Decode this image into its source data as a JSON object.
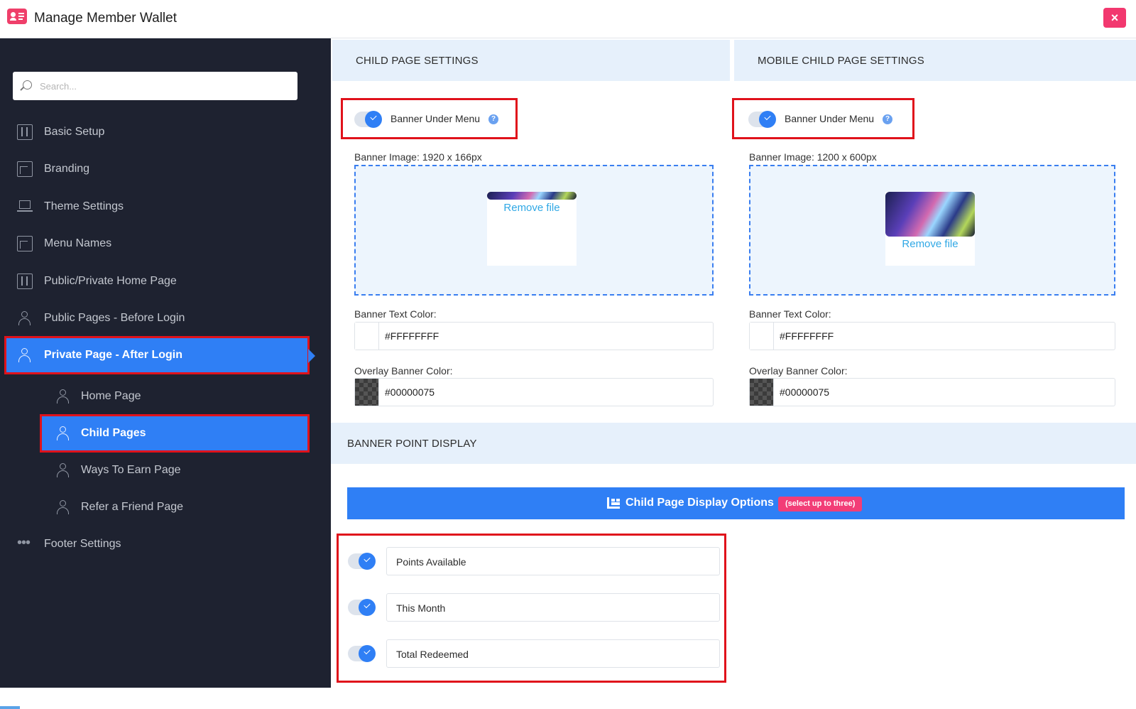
{
  "app": {
    "title": "Manage Member Wallet",
    "close_symbol": "×"
  },
  "sidebar": {
    "search_placeholder": "Search...",
    "items": [
      {
        "label": "Basic Setup",
        "icon": "sliders-icon"
      },
      {
        "label": "Branding",
        "icon": "frame-icon"
      },
      {
        "label": "Theme Settings",
        "icon": "laptop-icon"
      },
      {
        "label": "Menu Names",
        "icon": "frame-icon"
      },
      {
        "label": "Public/Private Home Page",
        "icon": "sliders-icon"
      },
      {
        "label": "Public Pages - Before Login",
        "icon": "person-icon"
      },
      {
        "label": "Private Page - After Login",
        "icon": "person-icon",
        "active": true
      },
      {
        "label": "Home Page",
        "icon": "person-icon"
      },
      {
        "label": "Child Pages",
        "icon": "person-icon",
        "active": true
      },
      {
        "label": "Ways To Earn Page",
        "icon": "person-icon"
      },
      {
        "label": "Refer a Friend Page",
        "icon": "person-icon"
      },
      {
        "label": "Footer Settings",
        "icon": "more-dots-icon"
      }
    ]
  },
  "child_settings": {
    "heading": "CHILD PAGE SETTINGS",
    "banner_toggle_label": "Banner Under Menu",
    "banner_toggle_on": true,
    "help_symbol": "?",
    "banner_image_label": "Banner Image: 1920 x 166px",
    "remove_file": "Remove file",
    "text_color_label": "Banner Text Color:",
    "text_color_value": "#FFFFFFFF",
    "overlay_label": "Overlay Banner Color:",
    "overlay_value": "#00000075"
  },
  "mobile_settings": {
    "heading": "MOBILE CHILD PAGE SETTINGS",
    "banner_toggle_label": "Banner Under Menu",
    "banner_toggle_on": true,
    "help_symbol": "?",
    "banner_image_label": "Banner Image: 1200 x 600px",
    "remove_file": "Remove file",
    "text_color_label": "Banner Text Color:",
    "text_color_value": "#FFFFFFFF",
    "overlay_label": "Overlay Banner Color:",
    "overlay_value": "#00000075"
  },
  "point_display": {
    "heading": "BANNER POINT DISPLAY",
    "options_title": "Child Page Display Options",
    "options_badge": "(select up to three)",
    "options": [
      {
        "label": "Points Available",
        "enabled": true
      },
      {
        "label": "This Month",
        "enabled": true
      },
      {
        "label": "Total Redeemed",
        "enabled": true
      }
    ]
  },
  "colors": {
    "accent": "#2f7ff5",
    "sidebar_bg": "#1e2230",
    "highlight_border": "#e0121b",
    "close_button": "#f2386f",
    "badge": "#f23d77",
    "link": "#30a8e5"
  }
}
